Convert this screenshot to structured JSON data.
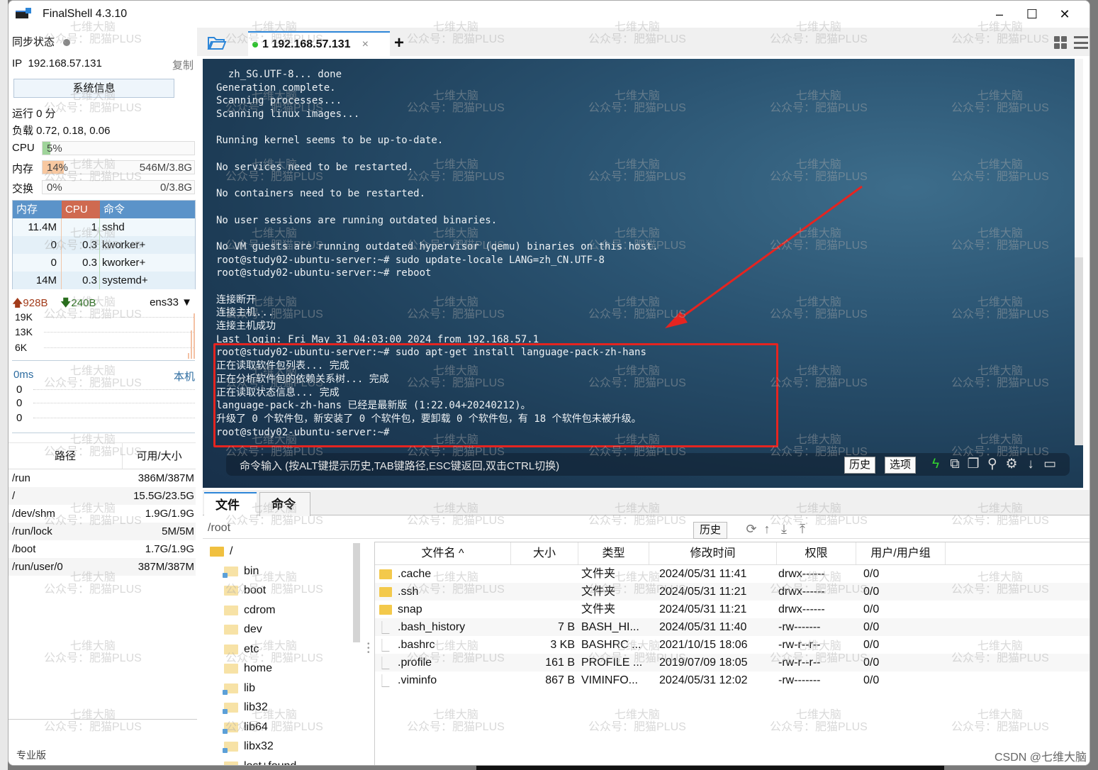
{
  "window": {
    "title": "FinalShell 4.3.10",
    "controls": {
      "minimize": "–",
      "maximize": "☐",
      "close": "✕"
    }
  },
  "sidebar": {
    "sync_label": "同步状态",
    "ip_label": "IP",
    "ip_value": "192.168.57.131",
    "copy_label": "复制",
    "sysinfo_button": "系统信息",
    "uptime": "运行 0 分",
    "load": "负载 0.72, 0.18, 0.06",
    "meters": [
      {
        "label": "CPU",
        "percent_text": "5%",
        "percent": 5,
        "amount": "",
        "color": "#9fd49a"
      },
      {
        "label": "内存",
        "percent_text": "14%",
        "percent": 14,
        "amount": "546M/3.8G",
        "color": "#f8c8a0"
      },
      {
        "label": "交换",
        "percent_text": "0%",
        "percent": 0,
        "amount": "0/3.8G",
        "color": "#cccccc"
      }
    ],
    "process_table": {
      "headers": {
        "mem": "内存",
        "cpu": "CPU",
        "cmd": "命令"
      },
      "header_colors": {
        "mem": "#5b93c9",
        "cpu": "#cf6a50",
        "cmd": "#5b93c9"
      },
      "rows": [
        {
          "mem": "11.4M",
          "cpu": "1",
          "cmd": "sshd"
        },
        {
          "mem": "0",
          "cpu": "0.3",
          "cmd": "kworker+"
        },
        {
          "mem": "0",
          "cpu": "0.3",
          "cmd": "kworker+"
        },
        {
          "mem": "14M",
          "cpu": "0.3",
          "cmd": "systemd+"
        }
      ]
    },
    "network": {
      "upload": "928B",
      "download": "240B",
      "interface": "ens33",
      "y_labels": [
        "19K",
        "13K",
        "6K"
      ]
    },
    "ping": {
      "latency": "0ms",
      "host": "本机",
      "values": [
        "0",
        "0",
        "0"
      ]
    },
    "disks": {
      "headers": {
        "path": "路径",
        "size": "可用/大小"
      },
      "rows": [
        {
          "path": "/run",
          "size": "386M/387M"
        },
        {
          "path": "/",
          "size": "15.5G/23.5G"
        },
        {
          "path": "/dev/shm",
          "size": "1.9G/1.9G"
        },
        {
          "path": "/run/lock",
          "size": "5M/5M"
        },
        {
          "path": "/boot",
          "size": "1.7G/1.9G"
        },
        {
          "path": "/run/user/0",
          "size": "387M/387M"
        }
      ]
    },
    "edition": "专业版"
  },
  "tabs": {
    "session_label": "1 192.168.57.131",
    "close": "×",
    "add": "+"
  },
  "terminal": {
    "lines": [
      "  zh_SG.UTF-8... done",
      "Generation complete.",
      "Scanning processes...",
      "Scanning linux images...",
      "",
      "Running kernel seems to be up-to-date.",
      "",
      "No services need to be restarted.",
      "",
      "No containers need to be restarted.",
      "",
      "No user sessions are running outdated binaries.",
      "",
      "No VM guests are running outdated hypervisor (qemu) binaries on this host.",
      "root@study02-ubuntu-server:~# sudo update-locale LANG=zh_CN.UTF-8",
      "root@study02-ubuntu-server:~# reboot",
      "",
      "连接断开",
      "连接主机...",
      "连接主机成功",
      "Last login: Fri May 31 04:03:00 2024 from 192.168.57.1",
      "root@study02-ubuntu-server:~# sudo apt-get install language-pack-zh-hans",
      "正在读取软件包列表... 完成",
      "正在分析软件包的依赖关系树... 完成",
      "正在读取状态信息... 完成",
      "language-pack-zh-hans 已经是最新版 (1:22.04+20240212)。",
      "升级了 0 个软件包，新安装了 0 个软件包，要卸载 0 个软件包，有 18 个软件包未被升级。",
      "root@study02-ubuntu-server:~# "
    ],
    "command_hint": "命令输入 (按ALT键提示历史,TAB键路径,ESC键返回,双击CTRL切换)",
    "history_button": "历史",
    "options_button": "选项",
    "annotation_color": "#e52420"
  },
  "file_panel": {
    "tabs": [
      "文件",
      "命令"
    ],
    "path": "/root",
    "history_button": "历史",
    "tree": [
      {
        "name": "/",
        "level": 0
      },
      {
        "name": "bin",
        "level": 1,
        "link": true
      },
      {
        "name": "boot",
        "level": 1
      },
      {
        "name": "cdrom",
        "level": 1
      },
      {
        "name": "dev",
        "level": 1
      },
      {
        "name": "etc",
        "level": 1
      },
      {
        "name": "home",
        "level": 1
      },
      {
        "name": "lib",
        "level": 1,
        "link": true
      },
      {
        "name": "lib32",
        "level": 1,
        "link": true
      },
      {
        "name": "lib64",
        "level": 1,
        "link": true
      },
      {
        "name": "libx32",
        "level": 1,
        "link": true
      },
      {
        "name": "lost+found",
        "level": 1
      }
    ],
    "columns": [
      "文件名 ^",
      "大小",
      "类型",
      "修改时间",
      "权限",
      "用户/用户组"
    ],
    "files": [
      {
        "name": ".cache",
        "size": "",
        "type": "文件夹",
        "mtime": "2024/05/31 11:41",
        "perm": "drwx------",
        "owner": "0/0",
        "dir": true
      },
      {
        "name": ".ssh",
        "size": "",
        "type": "文件夹",
        "mtime": "2024/05/31 11:21",
        "perm": "drwx------",
        "owner": "0/0",
        "dir": true
      },
      {
        "name": "snap",
        "size": "",
        "type": "文件夹",
        "mtime": "2024/05/31 11:21",
        "perm": "drwx------",
        "owner": "0/0",
        "dir": true
      },
      {
        "name": ".bash_history",
        "size": "7 B",
        "type": "BASH_HI...",
        "mtime": "2024/05/31 11:40",
        "perm": "-rw-------",
        "owner": "0/0",
        "dir": false
      },
      {
        "name": ".bashrc",
        "size": "3 KB",
        "type": "BASHRC ...",
        "mtime": "2021/10/15 18:06",
        "perm": "-rw-r--r--",
        "owner": "0/0",
        "dir": false
      },
      {
        "name": ".profile",
        "size": "161 B",
        "type": "PROFILE ...",
        "mtime": "2019/07/09 18:05",
        "perm": "-rw-r--r--",
        "owner": "0/0",
        "dir": false
      },
      {
        "name": ".viminfo",
        "size": "867 B",
        "type": "VIMINFO...",
        "mtime": "2024/05/31 12:02",
        "perm": "-rw-------",
        "owner": "0/0",
        "dir": false
      }
    ]
  },
  "watermark": {
    "line1": "七维大脑",
    "line2": "公众号：肥猫PLUS"
  },
  "credit": "CSDN @七维大脑"
}
